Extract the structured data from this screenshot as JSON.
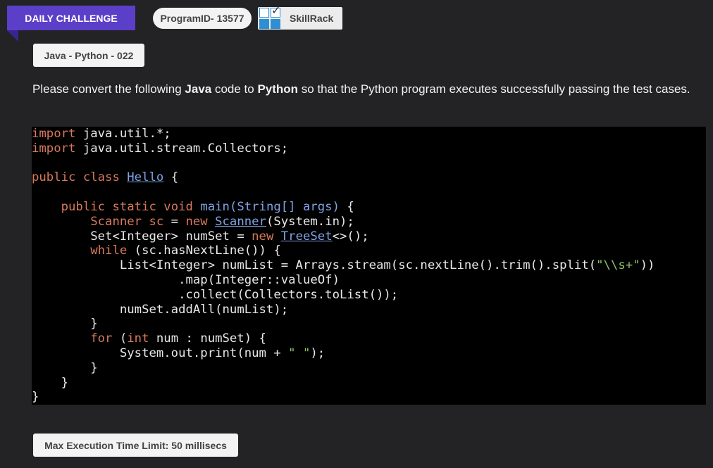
{
  "header": {
    "ribbon_label": "DAILY CHALLENGE",
    "program_id": "ProgramID- 13577",
    "brand_name": "SkillRack",
    "brand_logo_icon": "skillrack-logo-icon"
  },
  "tag_label": "Java - Python - 022",
  "description": {
    "part1": "Please convert the following ",
    "lang_from": "Java",
    "part2": " code to ",
    "lang_to": "Python",
    "part3": " so that the Python program executes successfully passing the test cases."
  },
  "code": {
    "l1a": "import",
    "l1b": " java.util.*;",
    "l2a": "import",
    "l2b": " java.util.stream.Collectors;",
    "l4a": "public class ",
    "l4b": "Hello",
    "l4c": " {",
    "l6a": "    ",
    "l6b": "public static void ",
    "l6c": "main(String[] args)",
    "l6d": " {",
    "l7a": "        ",
    "l7b": "Scanner sc",
    "l7c": " = ",
    "l7d": "new ",
    "l7e": "Scanner",
    "l7f": "(System.in);",
    "l8a": "        Set<Integer> numSet = ",
    "l8b": "new ",
    "l8c": "TreeSet",
    "l8d": "<>();",
    "l9a": "        ",
    "l9b": "while",
    "l9c": " (sc.hasNextLine()) {",
    "l10a": "            List<Integer> numList = Arrays.stream(sc.nextLine().trim().split(",
    "l10b": "\"\\\\s+\"",
    "l10c": "))",
    "l11": "                    .map(Integer::valueOf)",
    "l12": "                    .collect(Collectors.toList());",
    "l13": "            numSet.addAll(numList);",
    "l14": "        }",
    "l15a": "        ",
    "l15b": "for",
    "l15c": " (",
    "l15d": "int",
    "l15e": " num : numSet) {",
    "l16a": "            System.out.print(num + ",
    "l16b": "\" \"",
    "l16c": ");",
    "l17": "        }",
    "l18": "    }",
    "l19": "}"
  },
  "limit_label": "Max Execution Time Limit: 50 millisecs",
  "colors": {
    "ribbon": "#5b3fc8",
    "background": "#232325",
    "code_bg": "#000000",
    "keyword": "#d8795b",
    "type": "#7fa3e4",
    "string": "#8fc06a"
  }
}
